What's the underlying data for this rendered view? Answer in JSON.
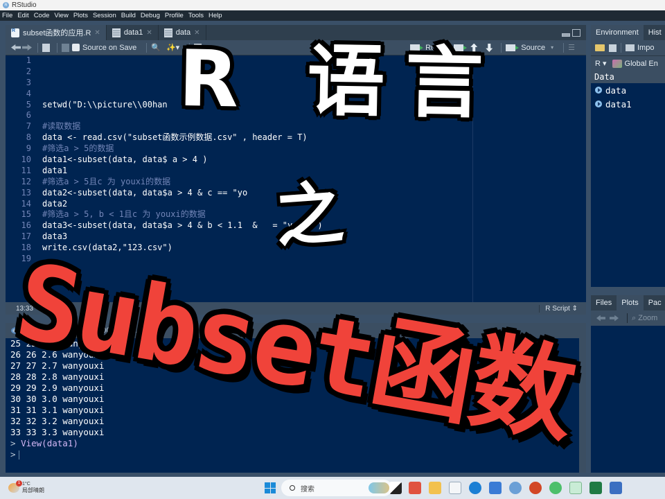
{
  "window": {
    "title": "RStudio"
  },
  "menu": [
    "File",
    "Edit",
    "Code",
    "View",
    "Plots",
    "Session",
    "Build",
    "Debug",
    "Profile",
    "Tools",
    "Help"
  ],
  "editor": {
    "tabs": [
      {
        "label": "subset函数的应用.R",
        "icon": "r-file-icon",
        "active": true
      },
      {
        "label": "data1",
        "icon": "table-icon",
        "active": false
      },
      {
        "label": "data",
        "icon": "table-icon",
        "active": false
      }
    ],
    "toolbar": {
      "source_on_save": "Source on Save",
      "run": "Run",
      "source": "Source"
    },
    "lines": [
      {
        "n": "1",
        "code": "",
        "type": "code"
      },
      {
        "n": "2",
        "code": "",
        "type": "code"
      },
      {
        "n": "3",
        "code": "",
        "type": "code"
      },
      {
        "n": "4",
        "code": "",
        "type": "code"
      },
      {
        "n": "5",
        "code": "setwd(\"D:\\\\picture\\\\00han    \\\\s   et\")",
        "type": "code"
      },
      {
        "n": "6",
        "code": "",
        "type": "code"
      },
      {
        "n": "7",
        "code": "#读取数据",
        "type": "comment"
      },
      {
        "n": "8",
        "code": "data <- read.csv(\"subset函数示例数据.csv\" , header = T)",
        "type": "code"
      },
      {
        "n": "9",
        "code": "#筛选a > 5的数据",
        "type": "comment"
      },
      {
        "n": "10",
        "code": "data1<-subset(data, data$ a > 4 )",
        "type": "code"
      },
      {
        "n": "11",
        "code": "data1",
        "type": "code"
      },
      {
        "n": "12",
        "code": "#筛选a > 5且c 为 youxi的数据",
        "type": "comment"
      },
      {
        "n": "13",
        "code": "data2<-subset(data, data$a > 4 & c == \"yo",
        "type": "code"
      },
      {
        "n": "14",
        "code": "data2",
        "type": "code"
      },
      {
        "n": "15",
        "code": "#筛选a > 5, b < 1且c 为 youxi的数据",
        "type": "comment"
      },
      {
        "n": "16",
        "code": "data3<-subset(data, data$a > 4 & b < 1.1  &   = \"youxi\")",
        "type": "code"
      },
      {
        "n": "17",
        "code": "data3",
        "type": "code"
      },
      {
        "n": "18",
        "code": "write.csv(data2,\"123.csv\")",
        "type": "code"
      },
      {
        "n": "19",
        "code": "",
        "type": "code"
      }
    ],
    "status": {
      "position": "13:33",
      "file_type": "R Script"
    }
  },
  "console": {
    "version": "R 4.1.0",
    "path": "D:/picture/00hansh.../",
    "output": [
      "25 25 2.5 wanyouxi",
      "26 26 2.6 wanyouxi",
      "27 27 2.7 wanyouxi",
      "28 28 2.8 wanyouxi",
      "29 29 2.9 wanyouxi",
      "30 30 3.0 wanyouxi",
      "31 31 3.1 wanyouxi",
      "32 32 3.2 wanyouxi",
      "33 33 3.3 wanyouxi"
    ],
    "last_command": "View(data1)",
    "prompt": ">"
  },
  "environment": {
    "tabs": [
      "Environment",
      "Hist"
    ],
    "import_label": "Impo",
    "language": "R",
    "scope": "Global En",
    "section": "Data",
    "items": [
      "data",
      "data1"
    ]
  },
  "files_pane": {
    "tabs": [
      "Files",
      "Plots",
      "Pac"
    ],
    "zoom_label": "Zoom"
  },
  "taskbar": {
    "weather_temp": "1°C",
    "weather_desc": "局部晴朗",
    "notification_count": "1",
    "search_placeholder": "搜索"
  },
  "overlay": {
    "line1": "R 语言",
    "line2": "之",
    "line3": "Subset函数"
  },
  "colors": {
    "editor_bg": "#002451",
    "overlay_red": "#f0433a",
    "overlay_white": "#ffffff"
  }
}
